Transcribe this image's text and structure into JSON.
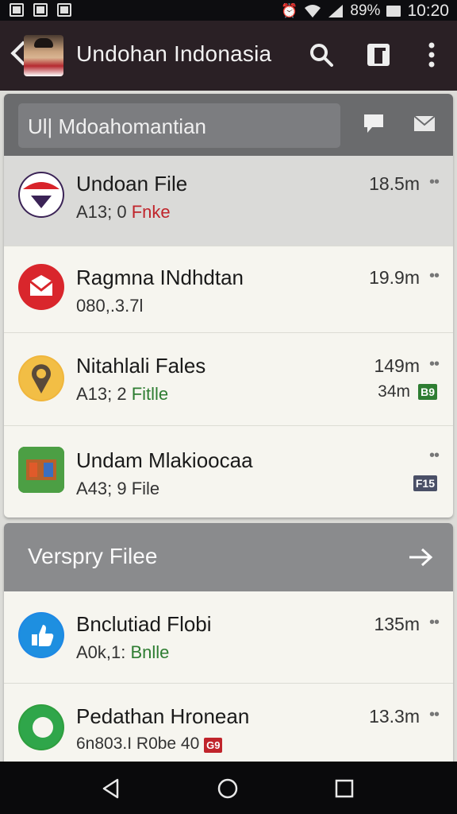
{
  "status_bar": {
    "battery": "89%",
    "time": "10:20",
    "left_icons": [
      "image-icon",
      "flag-icon",
      "calendar-icon"
    ],
    "right_icons": [
      "alarm-icon",
      "wifi-icon",
      "signal-icon",
      "battery-icon"
    ]
  },
  "app_bar": {
    "title": "Undohan Indonasia",
    "icons": [
      "back-arrow-icon",
      "search-icon",
      "square-icon",
      "more-vert-icon"
    ]
  },
  "filter": {
    "value": "Ul| Mdoahomantian",
    "icons": [
      "chat-icon",
      "mail-icon"
    ]
  },
  "files": [
    {
      "title": "Undoan File",
      "sub_prefix": "A13; 0 ",
      "sub_accent": "Fnke",
      "accent": "red",
      "size": "18.5m",
      "selected": true,
      "icon": "flag-badge-icon"
    },
    {
      "title": "Ragmna INdhdtan",
      "sub_prefix": "080,.3.7l",
      "sub_accent": "",
      "accent": "",
      "size": "19.9m",
      "selected": false,
      "icon": "red-envelope-icon"
    },
    {
      "title": "Nitahlali Fales",
      "sub_prefix": "A13; 2 ",
      "sub_accent": "Fitlle",
      "accent": "green",
      "size": "149m",
      "size2": "34m",
      "tag": "B9",
      "tag_color": "#2e7d32",
      "selected": false,
      "icon": "location-pin-icon"
    },
    {
      "title": "Undam Mlakioocaa",
      "sub_prefix": "A43; 9 File",
      "sub_accent": "",
      "accent": "",
      "size": "",
      "tag": "F15",
      "tag_color": "#4a4f66",
      "selected": false,
      "icon": "puzzle-icon"
    }
  ],
  "section": {
    "title": "Verspry Filee",
    "icon": "arrow-right-icon"
  },
  "section_files": [
    {
      "title": "Bnclutiad Flobi",
      "sub_prefix": "A0k,1: ",
      "sub_accent": "Bnlle",
      "accent": "green",
      "size": "135m",
      "icon": "thumbs-up-icon"
    },
    {
      "title": "Pedathan Hronean",
      "sub_prefix": "6n803.I R0be 40 ",
      "sub_accent": "",
      "accent": "",
      "size": "13.3m",
      "tag": "G9",
      "tag_color": "#c0242b",
      "icon": "green-ring-icon"
    }
  ],
  "nav": {
    "icons": [
      "nav-back-icon",
      "nav-home-icon",
      "nav-recents-icon"
    ]
  },
  "colors": {
    "appbar": "#2a2025",
    "accent_red": "#c0242b",
    "accent_green": "#2e7d32"
  }
}
